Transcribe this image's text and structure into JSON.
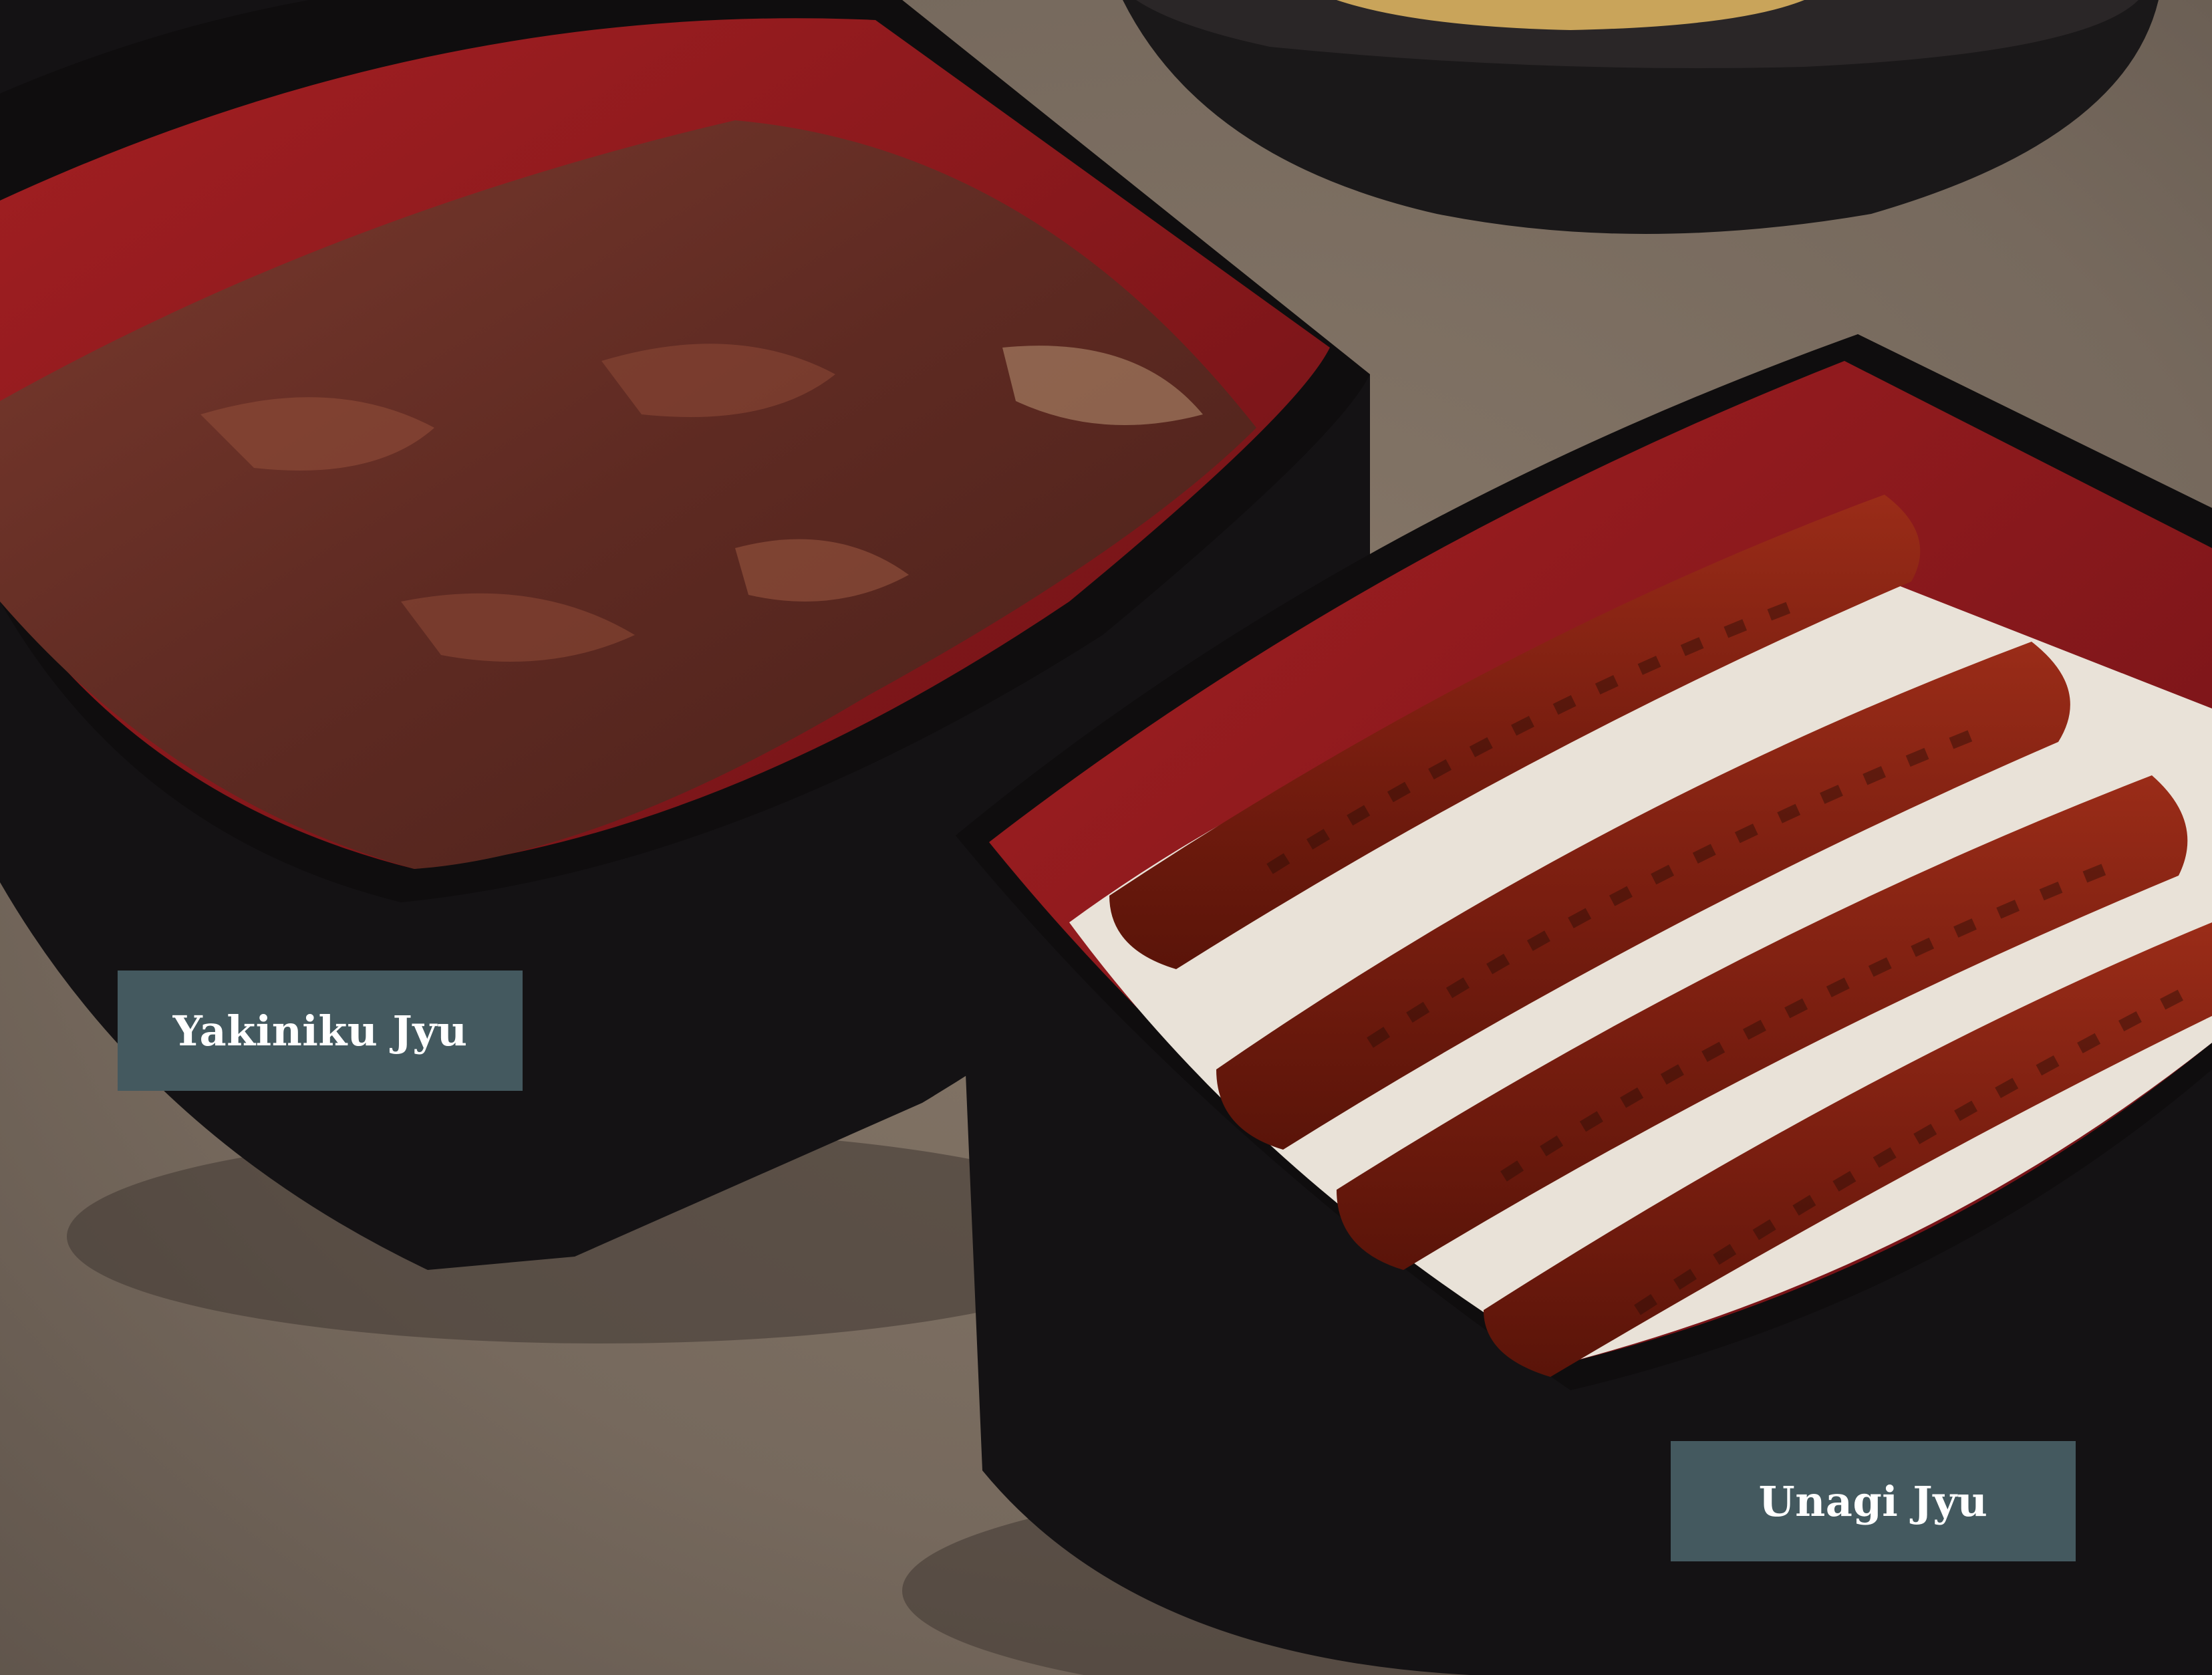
{
  "labels": {
    "yakiniku": "Yakiniku Jyu",
    "unagi": "Unagi Jyu"
  },
  "colors": {
    "label_background": "#44595f",
    "label_text": "#ffffff",
    "table_surface": "#7d6e62",
    "box_black": "#141214",
    "box_lining_red": "#8e1a1f",
    "beef": "#6b3026",
    "eel": "#7e2214"
  }
}
